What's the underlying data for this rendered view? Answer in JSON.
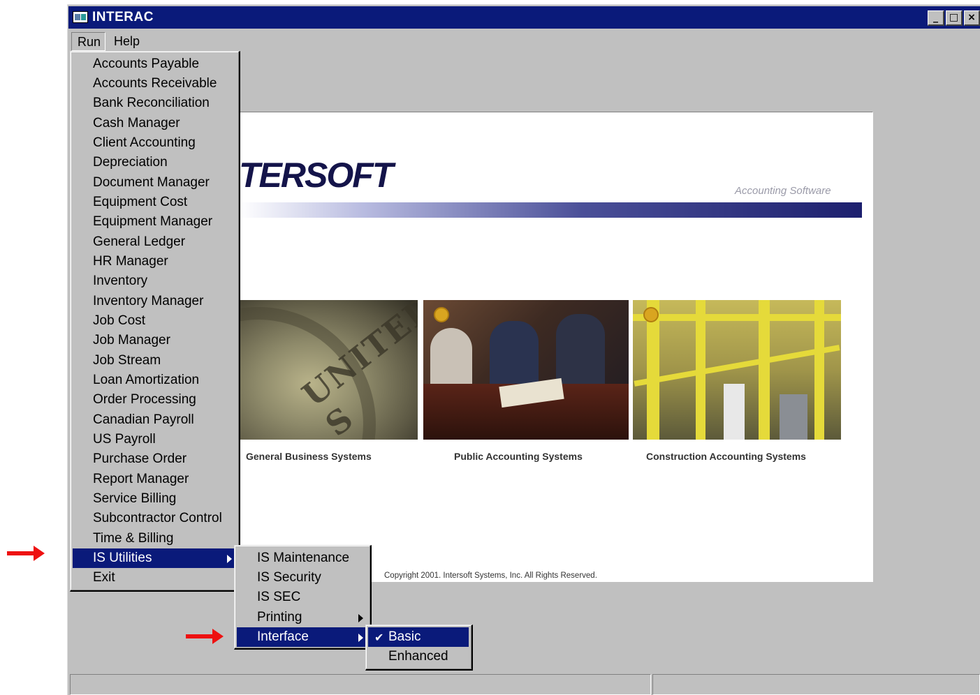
{
  "window": {
    "title": "INTERAC",
    "controls": {
      "minimize": "_",
      "maximize": "□",
      "close": "×"
    }
  },
  "menubar": {
    "run": "Run",
    "help": "Help"
  },
  "splash": {
    "logo": "TERSOFT",
    "tagline": "Accounting Software",
    "photo_text": "UNITED S",
    "captions": [
      "General Business Systems",
      "Public Accounting Systems",
      "Construction Accounting Systems"
    ],
    "copyright": "Copyright 2001.  Intersoft Systems, Inc.  All Rights Reserved."
  },
  "run_menu": {
    "items": [
      "Accounts Payable",
      "Accounts Receivable",
      "Bank Reconciliation",
      "Cash Manager",
      "Client Accounting",
      "Depreciation",
      "Document Manager",
      "Equipment Cost",
      "Equipment Manager",
      "General Ledger",
      "HR Manager",
      "Inventory",
      "Inventory Manager",
      "Job Cost",
      "Job Manager",
      "Job Stream",
      "Loan Amortization",
      "Order Processing",
      "Canadian Payroll",
      "US Payroll",
      "Purchase Order",
      "Report Manager",
      "Service Billing",
      "Subcontractor Control",
      "Time & Billing",
      "IS Utilities",
      "Exit"
    ],
    "selected": "IS Utilities"
  },
  "utilities_menu": {
    "items": [
      "IS Maintenance",
      "IS Security",
      "IS SEC",
      "Printing",
      "Interface"
    ],
    "selected": "Interface"
  },
  "interface_menu": {
    "items": [
      "Basic",
      "Enhanced"
    ],
    "checked": "Basic",
    "selected": "Basic"
  },
  "colors": {
    "title_bar": "#0a1a7a",
    "selection": "#0a1a7a",
    "face": "#c0c0c0",
    "annotation_arrow": "#ee1111"
  },
  "icons": {
    "checkmark": "check-icon",
    "submenu": "chevron-right-icon",
    "annotation": "red-arrow-icon"
  }
}
